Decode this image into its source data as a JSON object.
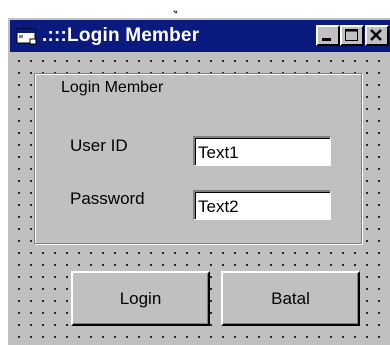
{
  "artifact": "ู",
  "window": {
    "title": ".:::Login Member",
    "icons": {
      "app": "window-app-icon",
      "minimize": "minimize-icon",
      "maximize": "maximize-icon",
      "close": "close-icon"
    }
  },
  "frame": {
    "label": "Login Member"
  },
  "fields": {
    "userid": {
      "label": "User ID",
      "value": "Text1"
    },
    "password": {
      "label": "Password",
      "value": "Text2"
    }
  },
  "buttons": {
    "login": "Login",
    "cancel": "Batal"
  },
  "colors": {
    "titlebar": "#0a1a7e",
    "face": "#c0c0c0",
    "text": "#000000",
    "input_bg": "#ffffff"
  }
}
